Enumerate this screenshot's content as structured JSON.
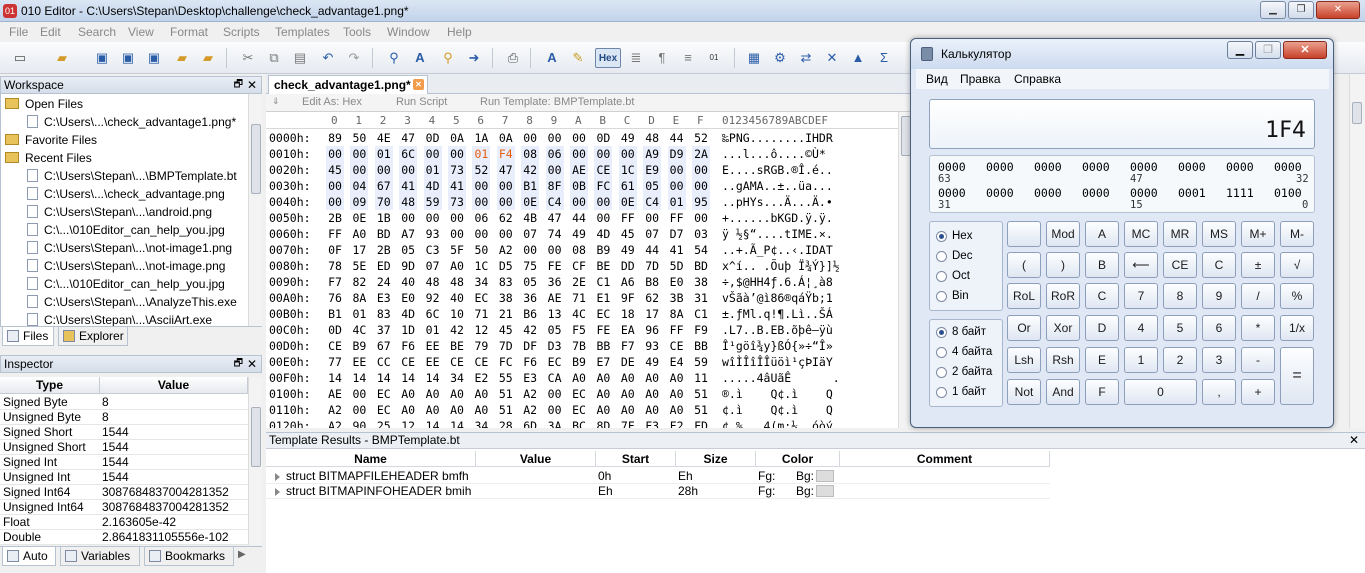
{
  "window": {
    "title": "010 Editor - C:\\Users\\Stepan\\Desktop\\challenge\\check_advantage1.png*"
  },
  "menu": [
    "File",
    "Edit",
    "Search",
    "View",
    "Format",
    "Scripts",
    "Templates",
    "Tools",
    "Window",
    "Help"
  ],
  "toolbar": {
    "hex_label": "Hex"
  },
  "workspace": {
    "title": "Workspace",
    "open_files_label": "Open Files",
    "open_files": [
      "C:\\Users\\...\\check_advantage1.png*"
    ],
    "favorite_files_label": "Favorite Files",
    "recent_files_label": "Recent Files",
    "recent_files": [
      "C:\\Users\\Stepan\\...\\BMPTemplate.bt",
      "C:\\Users\\...\\check_advantage.png",
      "C:\\Users\\Stepan\\...\\android.png",
      "C:\\...\\010Editor_can_help_you.jpg",
      "C:\\Users\\Stepan\\...\\not-image1.png",
      "C:\\Users\\Stepan\\...\\not-image.png",
      "C:\\...\\010Editor_can_help_you.jpg",
      "C:\\Users\\Stepan\\...\\AnalyzeThis.exe",
      "C:\\Users\\Stepan\\...\\AsciiArt.exe"
    ],
    "tabs": [
      "Files",
      "Explorer"
    ]
  },
  "inspector": {
    "title": "Inspector",
    "col_type": "Type",
    "col_value": "Value",
    "rows": [
      {
        "type": "Signed Byte",
        "value": "8"
      },
      {
        "type": "Unsigned Byte",
        "value": "8"
      },
      {
        "type": "Signed Short",
        "value": "1544"
      },
      {
        "type": "Unsigned Short",
        "value": "1544"
      },
      {
        "type": "Signed Int",
        "value": "1544"
      },
      {
        "type": "Unsigned Int",
        "value": "1544"
      },
      {
        "type": "Signed Int64",
        "value": "3087684837004281352"
      },
      {
        "type": "Unsigned Int64",
        "value": "3087684837004281352"
      },
      {
        "type": "Float",
        "value": "2.163605e-42"
      },
      {
        "type": "Double",
        "value": "2.8641831105556e-102"
      }
    ],
    "tabs": [
      "Auto",
      "Variables",
      "Bookmarks"
    ]
  },
  "editor": {
    "tab_label": "check_advantage1.png*",
    "edit_as": "Edit As: Hex",
    "run_script": "Run Script",
    "run_template": "Run Template: BMPTemplate.bt",
    "col_header": [
      "0",
      "1",
      "2",
      "3",
      "4",
      "5",
      "6",
      "7",
      "8",
      "9",
      "A",
      "B",
      "C",
      "D",
      "E",
      "F"
    ],
    "ascii_header": "0123456789ABCDEF",
    "rows": [
      {
        "addr": "0000h:",
        "bytes": [
          "89",
          "50",
          "4E",
          "47",
          "0D",
          "0A",
          "1A",
          "0A",
          "00",
          "00",
          "00",
          "0D",
          "49",
          "48",
          "44",
          "52"
        ],
        "ascii": "‰PNG........IHDR"
      },
      {
        "addr": "0010h:",
        "bytes": [
          "00",
          "00",
          "01",
          "6C",
          "00",
          "00",
          "01",
          "F4",
          "08",
          "06",
          "00",
          "00",
          "00",
          "A9",
          "D9",
          "2A"
        ],
        "ascii": "...l...ô....©Ù*"
      },
      {
        "addr": "0020h:",
        "bytes": [
          "45",
          "00",
          "00",
          "00",
          "01",
          "73",
          "52",
          "47",
          "42",
          "00",
          "AE",
          "CE",
          "1C",
          "E9",
          "00",
          "00"
        ],
        "ascii": "E....sRGB.®Î.é.."
      },
      {
        "addr": "0030h:",
        "bytes": [
          "00",
          "04",
          "67",
          "41",
          "4D",
          "41",
          "00",
          "00",
          "B1",
          "8F",
          "0B",
          "FC",
          "61",
          "05",
          "00",
          "00"
        ],
        "ascii": "..gAMA..±..üa..."
      },
      {
        "addr": "0040h:",
        "bytes": [
          "00",
          "09",
          "70",
          "48",
          "59",
          "73",
          "00",
          "00",
          "0E",
          "C4",
          "00",
          "00",
          "0E",
          "C4",
          "01",
          "95"
        ],
        "ascii": "..pHYs...Ä...Ä.•"
      },
      {
        "addr": "0050h:",
        "bytes": [
          "2B",
          "0E",
          "1B",
          "00",
          "00",
          "00",
          "06",
          "62",
          "4B",
          "47",
          "44",
          "00",
          "FF",
          "00",
          "FF",
          "00"
        ],
        "ascii": "+......bKGD.ÿ.ÿ."
      },
      {
        "addr": "0060h:",
        "bytes": [
          "FF",
          "A0",
          "BD",
          "A7",
          "93",
          "00",
          "00",
          "00",
          "07",
          "74",
          "49",
          "4D",
          "45",
          "07",
          "D7",
          "03"
        ],
        "ascii": "ÿ ½§“....tIME.×."
      },
      {
        "addr": "0070h:",
        "bytes": [
          "0F",
          "17",
          "2B",
          "05",
          "C3",
          "5F",
          "50",
          "A2",
          "00",
          "00",
          "08",
          "B9",
          "49",
          "44",
          "41",
          "54"
        ],
        "ascii": "..+.Ã_P¢..‹.IDAT"
      },
      {
        "addr": "0080h:",
        "bytes": [
          "78",
          "5E",
          "ED",
          "9D",
          "07",
          "A0",
          "1C",
          "D5",
          "75",
          "FE",
          "CF",
          "BE",
          "DD",
          "7D",
          "5D",
          "BD"
        ],
        "ascii": "x^í.. .Õuþ Ï¾Ý}]½"
      },
      {
        "addr": "0090h:",
        "bytes": [
          "F7",
          "82",
          "24",
          "40",
          "48",
          "48",
          "34",
          "83",
          "05",
          "36",
          "2E",
          "C1",
          "A6",
          "B8",
          "E0",
          "38"
        ],
        "ascii": "÷‚$@HH4ƒ.6.Á¦¸à8"
      },
      {
        "addr": "00A0h:",
        "bytes": [
          "76",
          "8A",
          "E3",
          "E0",
          "92",
          "40",
          "EC",
          "38",
          "36",
          "AE",
          "71",
          "E1",
          "9F",
          "62",
          "3B",
          "31"
        ],
        "ascii": "vŠãà’@ì86®qáŸb;1"
      },
      {
        "addr": "00B0h:",
        "bytes": [
          "B1",
          "01",
          "83",
          "4D",
          "6C",
          "10",
          "71",
          "21",
          "B6",
          "13",
          "4C",
          "EC",
          "18",
          "17",
          "8A",
          "C1"
        ],
        "ascii": "±.ƒMl.q!¶.Lì..ŠÁ"
      },
      {
        "addr": "00C0h:",
        "bytes": [
          "0D",
          "4C",
          "37",
          "1D",
          "01",
          "42",
          "12",
          "45",
          "42",
          "05",
          "F5",
          "FE",
          "EA",
          "96",
          "FF",
          "F9"
        ],
        "ascii": ".L7..B.EB.õþê–ÿù"
      },
      {
        "addr": "00D0h:",
        "bytes": [
          "CE",
          "B9",
          "67",
          "F6",
          "EE",
          "BE",
          "79",
          "7D",
          "DF",
          "D3",
          "7B",
          "BB",
          "F7",
          "93",
          "CE",
          "BB"
        ],
        "ascii": "Î¹göî¾y}ßÓ{»÷“Î»"
      },
      {
        "addr": "00E0h:",
        "bytes": [
          "77",
          "EE",
          "CC",
          "CE",
          "EE",
          "CE",
          "CE",
          "FC",
          "F6",
          "EC",
          "B9",
          "E7",
          "DE",
          "49",
          "E4",
          "59"
        ],
        "ascii": "wîÌÎîÎÎüöì¹çÞIäY"
      },
      {
        "addr": "00F0h:",
        "bytes": [
          "14",
          "14",
          "14",
          "14",
          "14",
          "34",
          "E2",
          "55",
          "E3",
          "CA",
          "A0",
          "A0",
          "A0",
          "A0",
          "A0",
          "11"
        ],
        "ascii": ".....4âUãÊ      ."
      },
      {
        "addr": "0100h:",
        "bytes": [
          "AE",
          "00",
          "EC",
          "A0",
          "A0",
          "A0",
          "A0",
          "51",
          "A2",
          "00",
          "EC",
          "A0",
          "A0",
          "A0",
          "A0",
          "51"
        ],
        "ascii": "®.ì    Q¢.ì    Q"
      },
      {
        "addr": "0110h:",
        "bytes": [
          "A2",
          "00",
          "EC",
          "A0",
          "A0",
          "A0",
          "A0",
          "51",
          "A2",
          "00",
          "EC",
          "A0",
          "A0",
          "A0",
          "A0",
          "51"
        ],
        "ascii": "¢.ì    Q¢.ì    Q"
      },
      {
        "addr": "0120h:",
        "bytes": [
          "A2",
          "90",
          "25",
          "12",
          "14",
          "14",
          "34",
          "28",
          "6D",
          "3A",
          "BC",
          "8D",
          "7F",
          "F3",
          "F2",
          "FD"
        ],
        "ascii": "¢.%...4(m:¼..óòý"
      }
    ]
  },
  "template_results": {
    "title": "Template Results - BMPTemplate.bt",
    "columns": [
      "Name",
      "Value",
      "Start",
      "Size",
      "Color",
      "Comment"
    ],
    "rows": [
      {
        "name": "struct BITMAPFILEHEADER bmfh",
        "value": "",
        "start": "0h",
        "size": "Eh",
        "fg": "Fg:",
        "bg": "Bg:",
        "comment": ""
      },
      {
        "name": "struct BITMAPINFOHEADER bmih",
        "value": "",
        "start": "Eh",
        "size": "28h",
        "fg": "Fg:",
        "bg": "Bg:",
        "comment": ""
      }
    ]
  },
  "calculator": {
    "title": "Калькулятор",
    "menu": [
      "Вид",
      "Правка",
      "Справка"
    ],
    "display": "1F4",
    "bits_row1": [
      "0000",
      "0000",
      "0000",
      "0000",
      "0000",
      "0000",
      "0000",
      "0000"
    ],
    "bits_row1_idx": [
      "63",
      "47",
      "32"
    ],
    "bits_row2": [
      "0000",
      "0000",
      "0000",
      "0000",
      "0000",
      "0001",
      "1111",
      "0100"
    ],
    "bits_row2_idx": [
      "31",
      "15",
      "0"
    ],
    "radix": [
      "Hex",
      "Dec",
      "Oct",
      "Bin"
    ],
    "word": [
      "8 байт",
      "4 байта",
      "2 байта",
      "1 байт"
    ],
    "buttons": {
      "row1": [
        "",
        "Mod",
        "A",
        "MC",
        "MR",
        "MS",
        "M+",
        "M-"
      ],
      "row2": [
        "(",
        ")",
        "B",
        "⟵",
        "CE",
        "C",
        "±",
        "√"
      ],
      "row3": [
        "RoL",
        "RoR",
        "C",
        "7",
        "8",
        "9",
        "/",
        "%"
      ],
      "row4": [
        "Or",
        "Xor",
        "D",
        "4",
        "5",
        "6",
        "*",
        "1/x"
      ],
      "row5": [
        "Lsh",
        "Rsh",
        "E",
        "1",
        "2",
        "3",
        "-",
        "="
      ],
      "row6": [
        "Not",
        "And",
        "F",
        "0",
        ",",
        "+"
      ]
    }
  }
}
